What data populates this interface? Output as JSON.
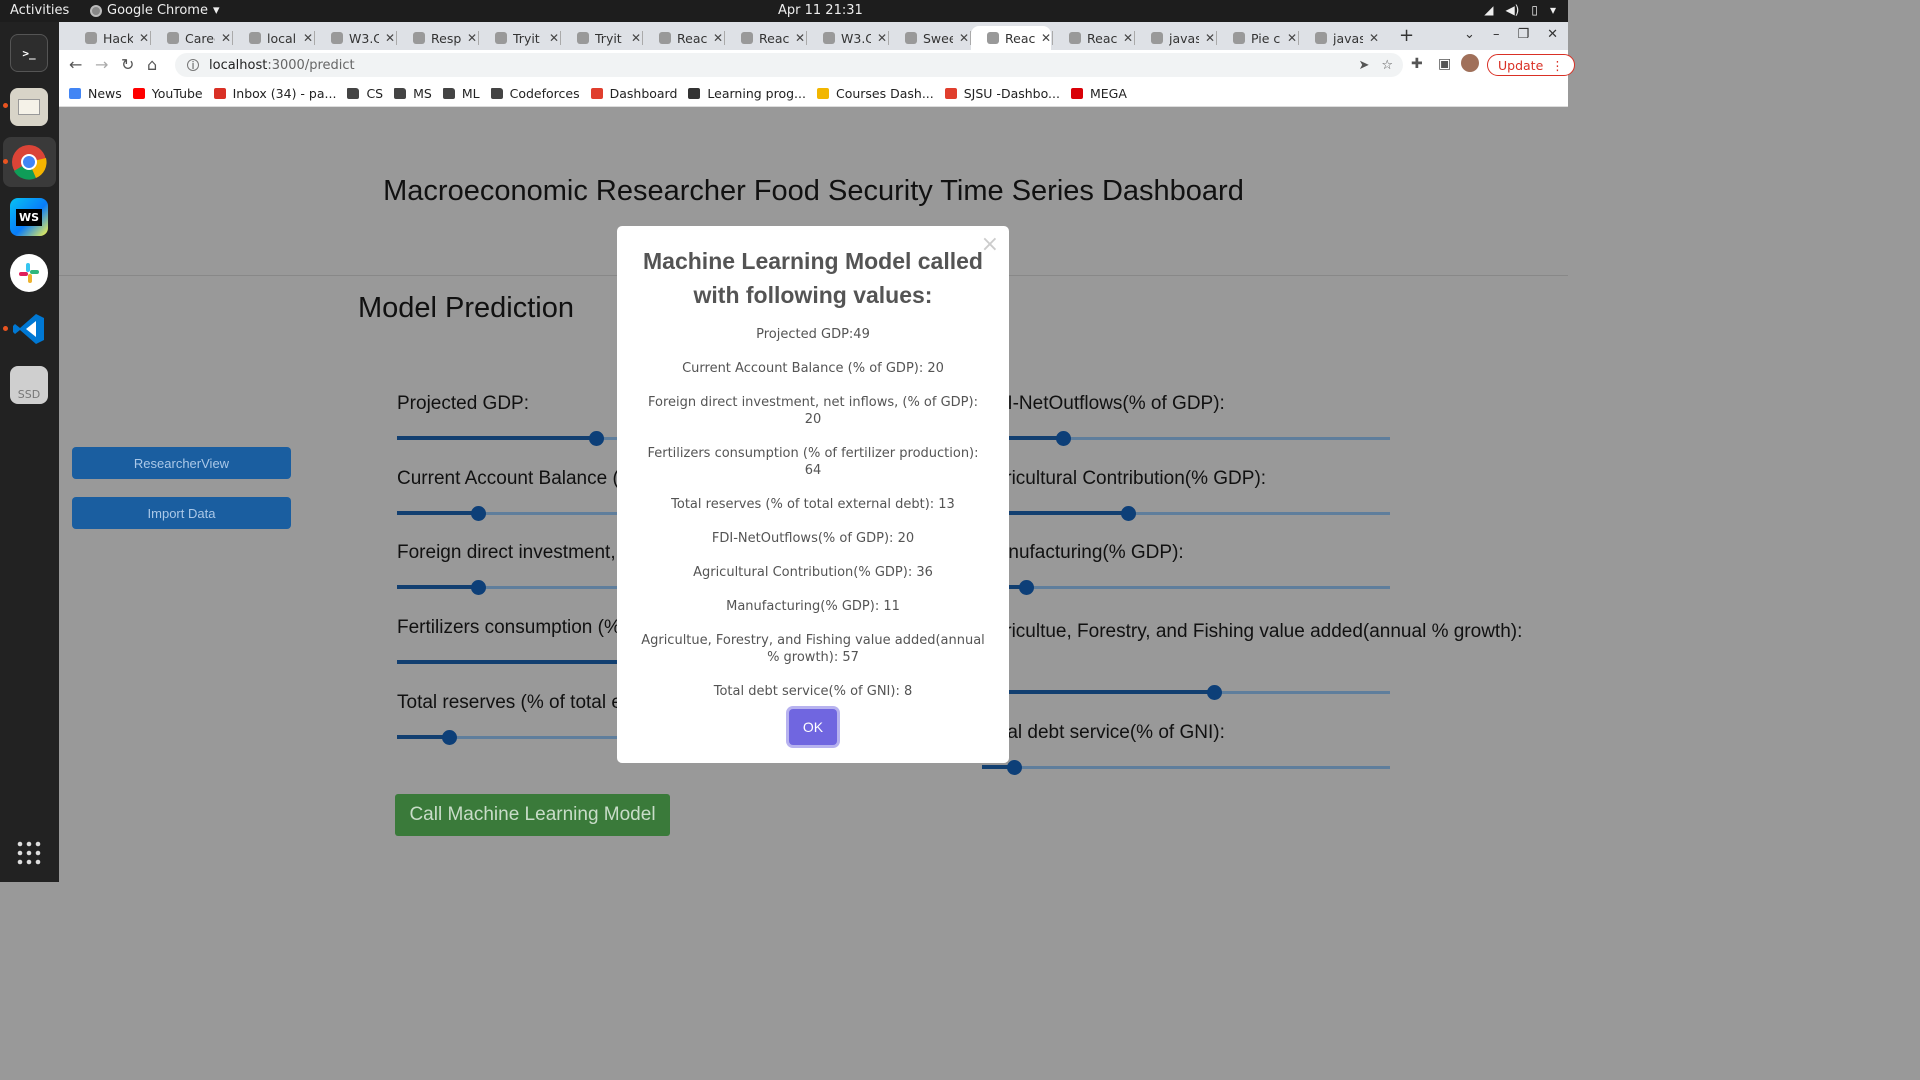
{
  "system": {
    "activities": "Activities",
    "app_name": "Google Chrome",
    "clock": "Apr 11  21:31"
  },
  "dock": {
    "items": [
      "terminal-icon",
      "files-icon",
      "chrome-icon",
      "webstorm-icon",
      "slack-icon",
      "vscode-icon",
      "ssd-drive-icon",
      "app-grid-icon"
    ],
    "ssd_label": "SSD",
    "webstorm_label": "WS"
  },
  "tabs": [
    {
      "title": "Hack",
      "active": false
    },
    {
      "title": "Caree",
      "active": false
    },
    {
      "title": "locall",
      "active": false
    },
    {
      "title": "W3.C",
      "active": false
    },
    {
      "title": "Respo",
      "active": false
    },
    {
      "title": "Tryit",
      "active": false
    },
    {
      "title": "Tryit",
      "active": false
    },
    {
      "title": "React",
      "active": false
    },
    {
      "title": "React",
      "active": false
    },
    {
      "title": "W3.C",
      "active": false
    },
    {
      "title": "Swee",
      "active": false
    },
    {
      "title": "React",
      "active": true
    },
    {
      "title": "React",
      "active": false
    },
    {
      "title": "javas",
      "active": false
    },
    {
      "title": "Pie ch",
      "active": false
    },
    {
      "title": "javas",
      "active": false
    }
  ],
  "address": {
    "host": "localhost",
    "path": ":3000/predict"
  },
  "update_label": "Update",
  "bookmarks": [
    {
      "label": "News",
      "icon": "news-icon",
      "color": "#4285f4"
    },
    {
      "label": "YouTube",
      "icon": "youtube-icon",
      "color": "#ff0000"
    },
    {
      "label": "Inbox (34) - pa...",
      "icon": "gmail-icon",
      "color": "#d93025"
    },
    {
      "label": "CS",
      "icon": "folder-icon",
      "color": "#444444"
    },
    {
      "label": "MS",
      "icon": "folder-icon",
      "color": "#444444"
    },
    {
      "label": "ML",
      "icon": "folder-icon",
      "color": "#444444"
    },
    {
      "label": "Codeforces",
      "icon": "folder-icon",
      "color": "#444444"
    },
    {
      "label": "Dashboard",
      "icon": "canvas-icon",
      "color": "#e03e2d"
    },
    {
      "label": "Learning prog...",
      "icon": "learning-icon",
      "color": "#333333"
    },
    {
      "label": "Courses Dash...",
      "icon": "crown-icon",
      "color": "#f2b600"
    },
    {
      "label": "SJSU -Dashbo...",
      "icon": "canvas-icon",
      "color": "#e03e2d"
    },
    {
      "label": "MEGA",
      "icon": "mega-icon",
      "color": "#d90007"
    }
  ],
  "page": {
    "title": "Macroeconomic Researcher Food Security Time Series Dashboard",
    "section_title": "Model Prediction",
    "side_buttons": [
      "ResearcherView",
      "Import Data"
    ],
    "left_sliders": [
      {
        "label": "Projected GDP:",
        "value": 49
      },
      {
        "label": "Current Account Balance (% of GDP):",
        "value": 20
      },
      {
        "label": "Foreign direct investment, net inflows, (% of GDP):",
        "value": 20
      },
      {
        "label": "Fertilizers consumption (% of fertilizer production):",
        "value": 64
      },
      {
        "label": "Total reserves (% of total external debt):",
        "value": 13
      }
    ],
    "right_sliders": [
      {
        "label": "FDI-NetOutflows(% of GDP):",
        "value": 20
      },
      {
        "label": "Agricultural Contribution(% GDP):",
        "value": 36
      },
      {
        "label": "Manufacturing(% GDP):",
        "value": 11
      },
      {
        "label": "Agricultue, Forestry, and Fishing value added(annual % growth):",
        "value": 57
      },
      {
        "label": "Total debt service(% of GNI):",
        "value": 8
      }
    ],
    "call_button": "Call Machine Learning Model"
  },
  "modal": {
    "title": "Machine Learning Model called with following values:",
    "lines": [
      "Projected GDP:49",
      "Current Account Balance (% of GDP): 20",
      "Foreign direct investment, net inflows, (% of GDP): 20",
      "Fertilizers consumption (% of fertilizer production): 64",
      "Total reserves (% of total external debt): 13",
      "FDI-NetOutflows(% of GDP): 20",
      "Agricultural Contribution(% GDP): 36",
      "Manufacturing(% GDP): 11",
      "Agricultue, Forestry, and Fishing value added(annual % growth): 57",
      "Total debt service(% of GNI): 8"
    ],
    "close_glyph": "×",
    "ok_label": "OK"
  },
  "colors": {
    "slider_thumb": "#0d3f78",
    "side_button": "#1a5ea0",
    "call_button": "#3a7a3a",
    "ok_button": "#7066e0"
  }
}
